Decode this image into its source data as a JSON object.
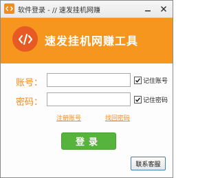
{
  "window": {
    "title": "软件登录 - // 速发挂机网赚"
  },
  "banner": {
    "heading": "速发挂机网赚工具",
    "background_color": "#f7961f",
    "logo_color": "#e85a24",
    "logo_icon": "code-icon"
  },
  "form": {
    "account_label": "账号：",
    "account_value": "",
    "password_label": "密码：",
    "password_value": "",
    "remember_account_label": "记住账号",
    "remember_account_checked": true,
    "remember_password_label": "记住密码",
    "remember_password_checked": true,
    "register_link": "注册账号",
    "recover_link": "找回密码",
    "accent_color": "#f08c21"
  },
  "actions": {
    "login_label": "登录",
    "login_color": "#56b33c",
    "support_label": "联系客服"
  }
}
